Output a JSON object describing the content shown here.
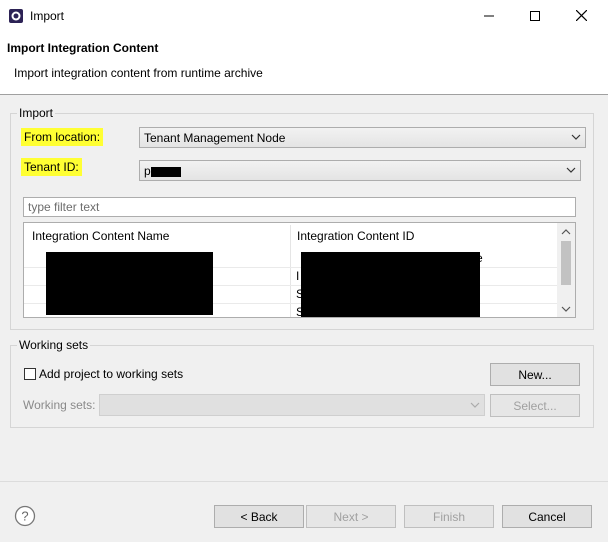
{
  "window": {
    "title": "Import",
    "minimize_glyph": "—",
    "maximize_glyph": "☐",
    "close_glyph": "✕"
  },
  "banner": {
    "title": "Import Integration Content",
    "description": "Import integration content from runtime archive"
  },
  "import_group": {
    "label": "Import",
    "from_location_label": "From location:",
    "from_location_value": "Tenant Management Node",
    "tenant_id_label": "Tenant ID:",
    "tenant_id_value": "p",
    "filter_placeholder": "type filter text",
    "table": {
      "columns": [
        "Integration Content Name",
        "Integration Content ID"
      ],
      "visible_fragments": {
        "id_row1_suffix": "e",
        "id_row2_prefix": "I",
        "id_row3_prefix": "S",
        "id_row4_prefix": "S"
      }
    }
  },
  "working_sets": {
    "label": "Working sets",
    "add_checkbox_label": "Add project to working sets",
    "add_checked": false,
    "new_button": "New...",
    "working_sets_label": "Working sets:",
    "select_button": "Select..."
  },
  "footer": {
    "back": "< Back",
    "next": "Next >",
    "finish": "Finish",
    "cancel": "Cancel"
  },
  "colors": {
    "highlight": "#ffff33",
    "redaction": "#000000"
  },
  "icons": {
    "app": "eclipse-icon",
    "help": "help-icon"
  }
}
